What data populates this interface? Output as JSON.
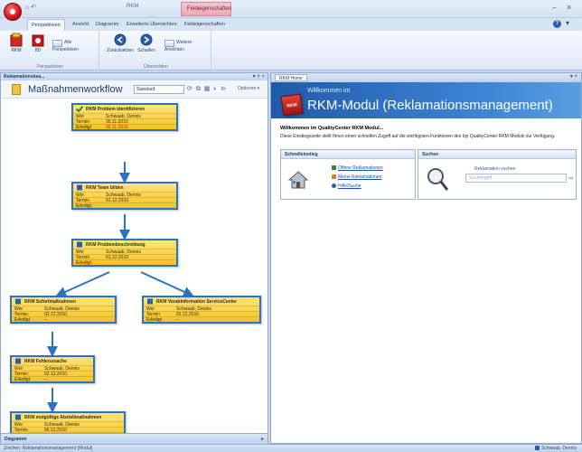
{
  "titlebar": {
    "qat": "⌂ ↶",
    "title": "RKM",
    "context_tab_group": "Feldeigenschaften",
    "min": "–",
    "close": "×"
  },
  "ribbon": {
    "tabs": [
      "Perspektiven",
      "Ansicht",
      "Diagramm",
      "Erweiterte Übersichten",
      "Feldeigenschaften"
    ],
    "groups": {
      "perspektiven": {
        "label": "Perspektiven",
        "rkm_label": "RKM",
        "8d_label": "8D",
        "all_perspectives": "Alle Perspektiven"
      },
      "view": {
        "label": "Übersichten",
        "prev_label": "Zurücksetzen",
        "next_label": "Schalten",
        "views_label": "Weitere Ansichten"
      }
    }
  },
  "left_pane": {
    "title": "Reklamationsbea...",
    "controls": "▾ × ×",
    "toolbar": {
      "title": "Maßnahmenworkflow",
      "view_select": "Standard",
      "icons": "⟳ ⧉ ▦ ◐ ⊳",
      "options": "Optionen ▾"
    },
    "footer_tab": "Diagramm",
    "scroll_arrow": "▸"
  },
  "wf_labels": {
    "who": "Wer",
    "date": "Termin",
    "done": "Erledigt"
  },
  "wf_nodes": [
    {
      "title": "RKM Problem identifizieren",
      "who": "Schwaab, Dennis",
      "date": "30.11.2010",
      "done": "30.11.2010",
      "late": true
    },
    {
      "title": "RKM Team bilden",
      "who": "Schwaab, Dennis",
      "date": "01.12.2010",
      "done": ""
    },
    {
      "title": "RKM Problembeschreibung",
      "who": "Schwaab, Dennis",
      "date": "01.12.2010",
      "done": ""
    },
    {
      "title": "RKM Sofortmaßnahmen",
      "who": "Schwaab, Dennis",
      "date": "02.12.2010",
      "done": "--"
    },
    {
      "title": "RKM Vorabinformation ServiceCenter",
      "who": "Schwaab, Dennis",
      "date": "01.12.2010",
      "done": "--"
    },
    {
      "title": "RKM Fehlerursache",
      "who": "Schwaab, Dennis",
      "date": "02.12.2010",
      "done": "--"
    },
    {
      "title": "RKM endgültige Abstellmaßnahmen",
      "who": "Schwaab, Dennis",
      "date": "06.12.2010",
      "done": ""
    }
  ],
  "right_pane": {
    "tab": "RKM Home",
    "controls": "▾ ×",
    "hero": {
      "welcome": "Willkommen im",
      "title": "RKM-Modul (Reklamationsmanagement)",
      "logo": "RKM"
    },
    "intro_title": "Willkommen im QualityCenter RKM Modul...",
    "intro_text": "Diese Einstiegsseite stellt Ihnen einen schnellen Zugriff auf die wichtigsten Funktionen des Iqs QualityCenter RKM Moduls zur Verfügung.",
    "quick": {
      "header": "Schnelleinstieg",
      "links": [
        "Offene Reklamationen",
        "Meine Reklamationen",
        "Hilfe/Suche"
      ]
    },
    "search": {
      "header": "Suchen",
      "label": "Reklamation suchen",
      "placeholder": "Suchbegriff",
      "go": "⇨"
    }
  },
  "statusbar": {
    "left": "Zeichen: Reklamationsmanagement (Modul)",
    "right": "Schwaab, Dennis"
  }
}
